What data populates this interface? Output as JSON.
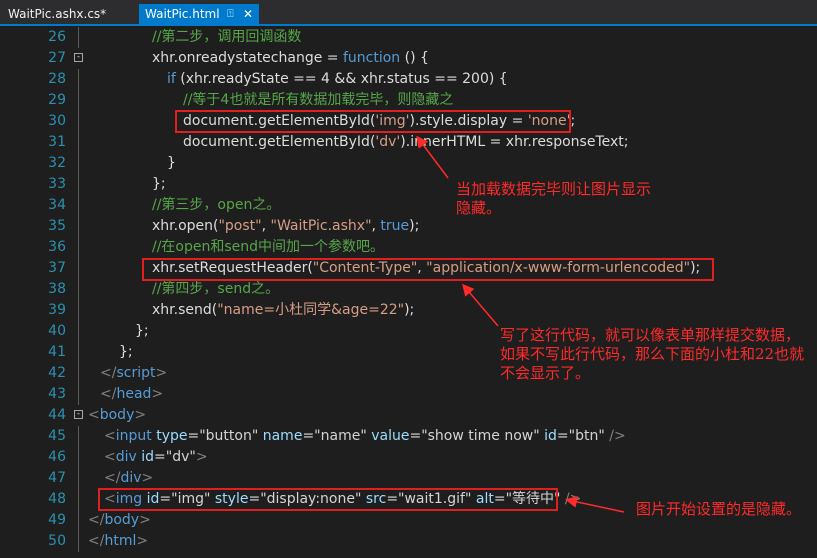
{
  "tabs": [
    {
      "label": "WaitPic.ashx.cs*",
      "active": false
    },
    {
      "label": "WaitPic.html",
      "active": true,
      "pin_icon": "pin-icon",
      "close_glyph": "✕"
    }
  ],
  "colors": {
    "accent": "#007acc",
    "comment": "#57a64a",
    "keyword": "#569cd6",
    "string": "#d69d85",
    "line_number": "#2b91af",
    "annotation": "#ff2a2a"
  },
  "code_lines": [
    {
      "n": "26",
      "tokens": [
        [
          "c",
          "//第二步，调用回调函数"
        ]
      ]
    },
    {
      "n": "27",
      "fold": "-",
      "tokens": [
        [
          "p",
          "xhr.onreadystatechange = "
        ],
        [
          "k",
          "function"
        ],
        [
          "p",
          " () {"
        ]
      ]
    },
    {
      "n": "28",
      "tokens": [
        [
          "k",
          "if"
        ],
        [
          "p",
          " (xhr.readyState == 4 && xhr.status == 200) {"
        ]
      ]
    },
    {
      "n": "29",
      "tokens": [
        [
          "c",
          "//等于4也就是所有数据加载完毕，则隐藏之"
        ]
      ]
    },
    {
      "n": "30",
      "tokens": [
        [
          "p",
          "document.getElementById("
        ],
        [
          "s",
          "'img'"
        ],
        [
          "p",
          ").style.display = "
        ],
        [
          "s",
          "'none'"
        ],
        [
          "p",
          ";"
        ]
      ]
    },
    {
      "n": "31",
      "tokens": [
        [
          "p",
          "document.getElementById("
        ],
        [
          "s",
          "'dv'"
        ],
        [
          "p",
          ").innerHTML = xhr.responseText;"
        ]
      ]
    },
    {
      "n": "32",
      "tokens": [
        [
          "p",
          "}"
        ]
      ]
    },
    {
      "n": "33",
      "tokens": [
        [
          "p",
          "};"
        ]
      ]
    },
    {
      "n": "34",
      "tokens": [
        [
          "c",
          "//第三步，open之。"
        ]
      ]
    },
    {
      "n": "35",
      "tokens": [
        [
          "p",
          "xhr.open("
        ],
        [
          "s",
          "\"post\""
        ],
        [
          "p",
          ", "
        ],
        [
          "s",
          "\"WaitPic.ashx\""
        ],
        [
          "p",
          ", "
        ],
        [
          "k",
          "true"
        ],
        [
          "p",
          ");"
        ]
      ]
    },
    {
      "n": "36",
      "tokens": [
        [
          "c",
          "//在open和send中间加一个参数吧。"
        ]
      ]
    },
    {
      "n": "37",
      "tokens": [
        [
          "p",
          "xhr.setRequestHeader("
        ],
        [
          "s",
          "\"Content-Type\""
        ],
        [
          "p",
          ", "
        ],
        [
          "s",
          "\"application/x-www-form-urlencoded\""
        ],
        [
          "p",
          ");"
        ]
      ]
    },
    {
      "n": "38",
      "tokens": [
        [
          "c",
          "//第四步，send之。"
        ]
      ]
    },
    {
      "n": "39",
      "tokens": [
        [
          "p",
          "xhr.send("
        ],
        [
          "s",
          "\"name=小杜同学&age=22\""
        ],
        [
          "p",
          ");"
        ]
      ]
    },
    {
      "n": "40",
      "tokens": [
        [
          "p",
          "};"
        ]
      ]
    },
    {
      "n": "41",
      "tokens": [
        [
          "p",
          "};"
        ]
      ]
    },
    {
      "n": "42",
      "tokens": [
        [
          "g",
          "</"
        ],
        [
          "t",
          "script"
        ],
        [
          "g",
          ">"
        ]
      ]
    },
    {
      "n": "43",
      "tokens": [
        [
          "g",
          "</"
        ],
        [
          "t",
          "head"
        ],
        [
          "g",
          ">"
        ]
      ]
    },
    {
      "n": "44",
      "fold": "-",
      "tokens": [
        [
          "g",
          "<"
        ],
        [
          "t",
          "body"
        ],
        [
          "g",
          ">"
        ]
      ]
    },
    {
      "n": "45",
      "tokens": [
        [
          "g",
          "<"
        ],
        [
          "t",
          "input"
        ],
        [
          "p",
          " "
        ],
        [
          "a",
          "type"
        ],
        [
          "p",
          "="
        ],
        [
          "v",
          "\"button\""
        ],
        [
          "p",
          " "
        ],
        [
          "a",
          "name"
        ],
        [
          "p",
          "="
        ],
        [
          "v",
          "\"name\""
        ],
        [
          "p",
          " "
        ],
        [
          "a",
          "value"
        ],
        [
          "p",
          "="
        ],
        [
          "v",
          "\"show time now\""
        ],
        [
          "p",
          " "
        ],
        [
          "a",
          "id"
        ],
        [
          "p",
          "="
        ],
        [
          "v",
          "\"btn\""
        ],
        [
          "p",
          " "
        ],
        [
          "g",
          "/>"
        ]
      ]
    },
    {
      "n": "46",
      "tokens": [
        [
          "g",
          "<"
        ],
        [
          "t",
          "div"
        ],
        [
          "p",
          " "
        ],
        [
          "a",
          "id"
        ],
        [
          "p",
          "="
        ],
        [
          "v",
          "\"dv\""
        ],
        [
          "g",
          ">"
        ]
      ]
    },
    {
      "n": "47",
      "tokens": [
        [
          "g",
          "</"
        ],
        [
          "t",
          "div"
        ],
        [
          "g",
          ">"
        ]
      ]
    },
    {
      "n": "48",
      "tokens": [
        [
          "g",
          "<"
        ],
        [
          "t",
          "img"
        ],
        [
          "p",
          " "
        ],
        [
          "a",
          "id"
        ],
        [
          "p",
          "="
        ],
        [
          "v",
          "\"img\""
        ],
        [
          "p",
          " "
        ],
        [
          "a",
          "style"
        ],
        [
          "p",
          "="
        ],
        [
          "v",
          "\"display:none\""
        ],
        [
          "p",
          " "
        ],
        [
          "a",
          "src"
        ],
        [
          "p",
          "="
        ],
        [
          "v",
          "\"wait1.gif\""
        ],
        [
          "p",
          " "
        ],
        [
          "a",
          "alt"
        ],
        [
          "p",
          "="
        ],
        [
          "v",
          "\"等待中\""
        ],
        [
          "p",
          " "
        ],
        [
          "g",
          "/>"
        ]
      ]
    },
    {
      "n": "49",
      "tokens": [
        [
          "g",
          "</"
        ],
        [
          "t",
          "body"
        ],
        [
          "g",
          ">"
        ]
      ]
    },
    {
      "n": "50",
      "tokens": [
        [
          "g",
          "</"
        ],
        [
          "t",
          "html"
        ],
        [
          "g",
          ">"
        ]
      ]
    }
  ],
  "annotations": {
    "hide_image": "当加载数据完毕则让图片显示隐藏。",
    "request_header": "写了这行代码，就可以像表单那样提交数据，如果不写此行代码，那么下面的小杜和22也就不会显示了。",
    "img_initial": "图片开始设置的是隐藏。"
  }
}
